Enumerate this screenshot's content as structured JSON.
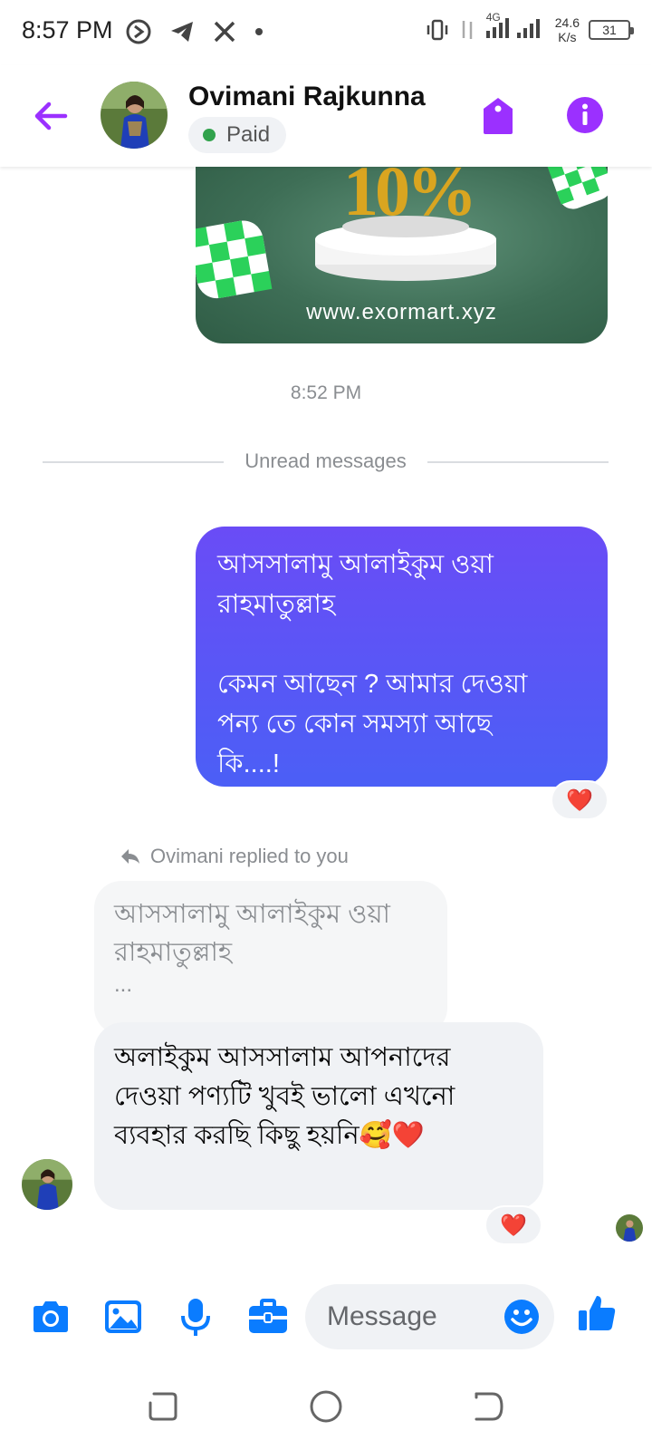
{
  "status_bar": {
    "time": "8:57 PM",
    "network": "4G",
    "speed_value": "24.6",
    "speed_unit": "K/s",
    "battery": "31"
  },
  "header": {
    "contact_name": "Ovimani Rajkunna",
    "status_badge": "Paid",
    "status_color": "#31a24c",
    "accent_color": "#9b30ff"
  },
  "chat": {
    "promo_url": "www.exormart.xyz",
    "promo_percent": "10%",
    "timestamp": "8:52 PM",
    "unread_divider": "Unread messages",
    "outgoing_message": "আসসালামু আলাইকুম ওয়া\nরাহমাতুল্লাহ\n\nকেমন আছেন ? আমার দেওয়া\nপন্য তে কোন সমস্যা আছে\nকি....!",
    "outgoing_reaction": "❤️",
    "reply_label": "Ovimani replied to you",
    "quoted_text_line1": "আসসালামু আলাইকুম ওয়া",
    "quoted_text_line2": "রাহমাতুল্লাহ",
    "quoted_ellipsis": "...",
    "incoming_message": "অলাইকুম আসসালাম আপনাদের দেওয়া পণ্যটি খুবই ভালো এখনো ব্যবহার করছি কিছু হয়নি🥰❤️",
    "incoming_reaction": "❤️"
  },
  "composer": {
    "placeholder": "Message",
    "icon_color": "#0a7cff"
  }
}
